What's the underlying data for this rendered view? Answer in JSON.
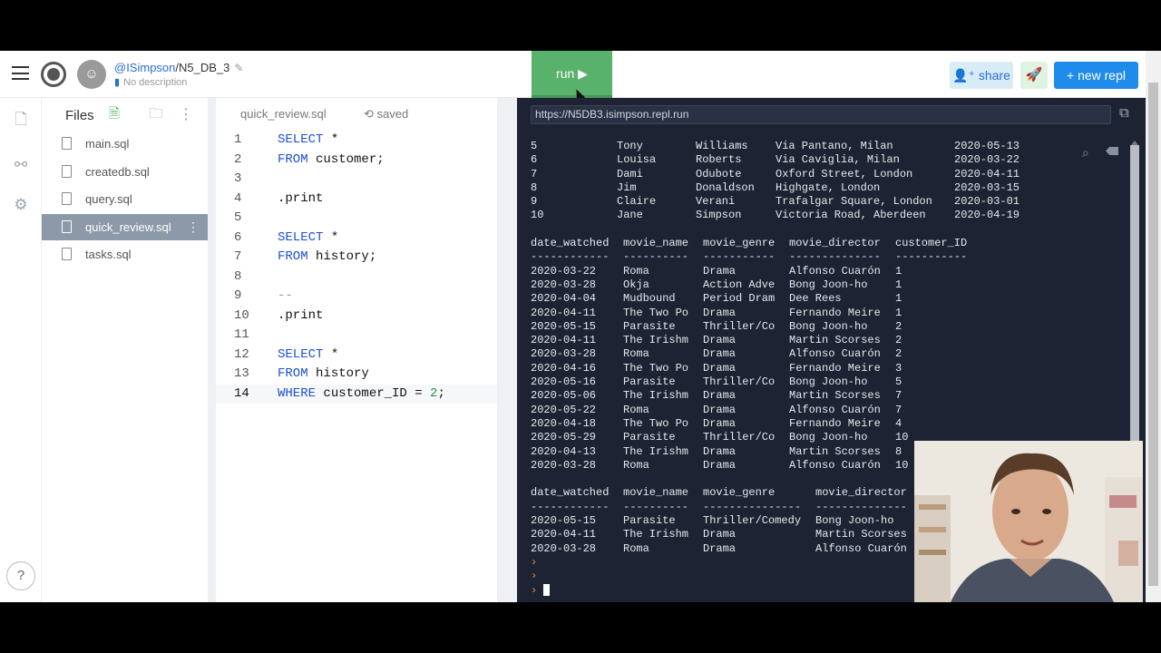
{
  "header": {
    "owner": "@ISimpson",
    "repl_name": "/N5_DB_3",
    "description": "No description",
    "run_label": "run ▶",
    "share_label": "share",
    "new_repl_label": "+ new repl"
  },
  "files": {
    "title": "Files",
    "items": [
      {
        "label": "main.sql"
      },
      {
        "label": "createdb.sql"
      },
      {
        "label": "query.sql"
      },
      {
        "label": "quick_review.sql",
        "active": true
      },
      {
        "label": "tasks.sql"
      }
    ]
  },
  "editor": {
    "tab_file": "quick_review.sql",
    "saved_label": "saved",
    "lines": [
      {
        "n": "1",
        "text": "SELECT *"
      },
      {
        "n": "2",
        "text": "FROM customer;"
      },
      {
        "n": "3",
        "text": ""
      },
      {
        "n": "4",
        "text": ".print"
      },
      {
        "n": "5",
        "text": ""
      },
      {
        "n": "6",
        "text": "SELECT *"
      },
      {
        "n": "7",
        "text": "FROM history;"
      },
      {
        "n": "8",
        "text": ""
      },
      {
        "n": "9",
        "text": "--"
      },
      {
        "n": "10",
        "text": ".print"
      },
      {
        "n": "11",
        "text": ""
      },
      {
        "n": "12",
        "text": "SELECT *"
      },
      {
        "n": "13",
        "text": "FROM history"
      },
      {
        "n": "14",
        "text": "WHERE customer_ID = 2;"
      }
    ]
  },
  "console": {
    "url": "https://N5DB3.isimpson.repl.run",
    "customer_rows": [
      [
        "5",
        "Tony",
        "Williams",
        "Via Pantano, Milan",
        "2020-05-13"
      ],
      [
        "6",
        "Louisa",
        "Roberts",
        "Via Caviglia, Milan",
        "2020-03-22"
      ],
      [
        "7",
        "Dami",
        "Odubote",
        "Oxford Street, London",
        "2020-04-11"
      ],
      [
        "8",
        "Jim",
        "Donaldson",
        "Highgate, London",
        "2020-03-15"
      ],
      [
        "9",
        "Claire",
        "Verani",
        "Trafalgar Square, London",
        "2020-03-01"
      ],
      [
        "10",
        "Jane",
        "Simpson",
        "Victoria Road, Aberdeen",
        "2020-04-19"
      ]
    ],
    "history_headers": [
      "date_watched",
      "movie_name",
      "movie_genre",
      "movie_director",
      "customer_ID"
    ],
    "history_underline": [
      "------------",
      "----------",
      "-----------",
      "--------------",
      "-----------"
    ],
    "history_rows": [
      [
        "2020-03-22",
        "Roma",
        "Drama",
        "Alfonso Cuarón",
        "1"
      ],
      [
        "2020-03-28",
        "Okja",
        "Action Adve",
        "Bong Joon-ho",
        "1"
      ],
      [
        "2020-04-04",
        "Mudbound",
        "Period Dram",
        "Dee Rees",
        "1"
      ],
      [
        "2020-04-11",
        "The Two Po",
        "Drama",
        "Fernando Meire",
        "1"
      ],
      [
        "2020-05-15",
        "Parasite",
        "Thriller/Co",
        "Bong Joon-ho",
        "2"
      ],
      [
        "2020-04-11",
        "The Irishm",
        "Drama",
        "Martin Scorses",
        "2"
      ],
      [
        "2020-03-28",
        "Roma",
        "Drama",
        "Alfonso Cuarón",
        "2"
      ],
      [
        "2020-04-16",
        "The Two Po",
        "Drama",
        "Fernando Meire",
        "3"
      ],
      [
        "2020-05-16",
        "Parasite",
        "Thriller/Co",
        "Bong Joon-ho",
        "5"
      ],
      [
        "2020-05-06",
        "The Irishm",
        "Drama",
        "Martin Scorses",
        "7"
      ],
      [
        "2020-05-22",
        "Roma",
        "Drama",
        "Alfonso Cuarón",
        "7"
      ],
      [
        "2020-04-18",
        "The Two Po",
        "Drama",
        "Fernando Meire",
        "4"
      ],
      [
        "2020-05-29",
        "Parasite",
        "Thriller/Co",
        "Bong Joon-ho",
        "10"
      ],
      [
        "2020-04-13",
        "The Irishm",
        "Drama",
        "Martin Scorses",
        "8"
      ],
      [
        "2020-03-28",
        "Roma",
        "Drama",
        "Alfonso Cuarón",
        "10"
      ]
    ],
    "filtered_headers": [
      "date_watched",
      "movie_name",
      "movie_genre",
      "movie_director"
    ],
    "filtered_underline": [
      "------------",
      "----------",
      "---------------",
      "--------------"
    ],
    "filtered_rows": [
      [
        "2020-05-15",
        "Parasite",
        "Thriller/Comedy",
        "Bong Joon-ho"
      ],
      [
        "2020-04-11",
        "The Irishm",
        "Drama",
        "Martin Scorses"
      ],
      [
        "2020-03-28",
        "Roma",
        "Drama",
        "Alfonso Cuarón"
      ]
    ],
    "prompt": "›"
  },
  "colors": {
    "run_green": "#59b26b",
    "console_bg": "#1d2333",
    "new_repl_blue": "#1f8ceb",
    "active_file_bg": "#8c99a8"
  }
}
